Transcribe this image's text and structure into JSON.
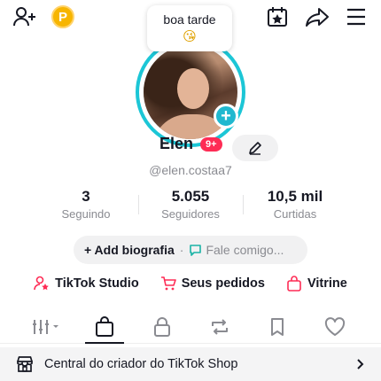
{
  "header": {
    "coin_letter": "P",
    "bubble_text": "boa tarde",
    "bubble_emoji": "😘"
  },
  "profile": {
    "name": "Elen",
    "badge": "9+",
    "username": "@elen.costaa7"
  },
  "stats": [
    {
      "value": "3",
      "label": "Seguindo"
    },
    {
      "value": "5.055",
      "label": "Seguidores"
    },
    {
      "value": "10,5 mil",
      "label": "Curtidas"
    }
  ],
  "bio": {
    "add_label": "+ Add biografia",
    "separator": "·",
    "chat_label": "Fale comigo..."
  },
  "links": {
    "studio": "TikTok Studio",
    "orders": "Seus pedidos",
    "showcase": "Vitrine"
  },
  "shop_bar": {
    "label": "Central do criador do TikTok Shop"
  },
  "colors": {
    "accent_red": "#fe2c55",
    "ring_cyan": "#1cc6d6",
    "coin": "#f7b500"
  }
}
